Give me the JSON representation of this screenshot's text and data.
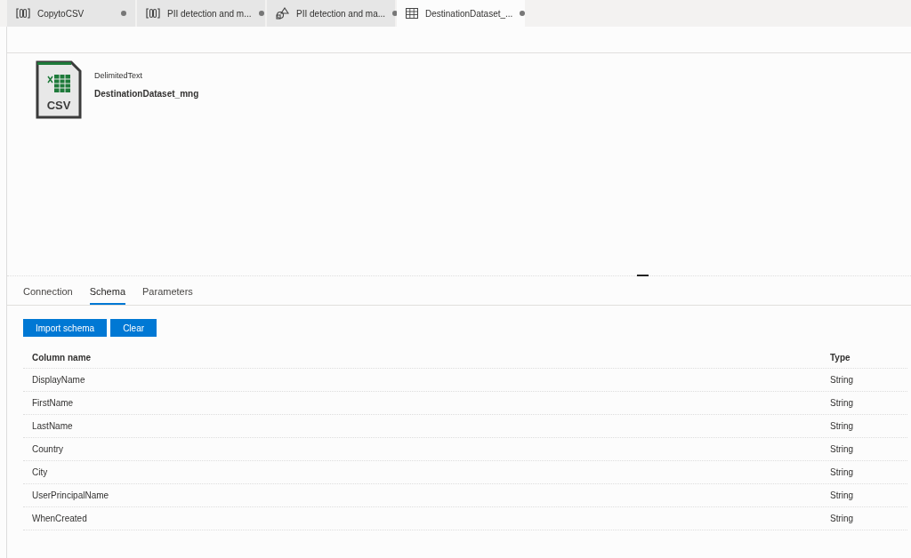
{
  "editor_tabs": [
    {
      "kind": "pipeline",
      "label": "CopytoCSV",
      "selected": false
    },
    {
      "kind": "pipeline",
      "label": "PII detection and m...",
      "selected": false
    },
    {
      "kind": "dataflow",
      "label": "PII detection and ma...",
      "selected": false
    },
    {
      "kind": "dataset",
      "label": "DestinationDataset_...",
      "selected": true
    }
  ],
  "dataset": {
    "type": "DelimitedText",
    "name": "DestinationDataset_mng",
    "icon_label": "CSV"
  },
  "section_tabs": [
    {
      "label": "Connection",
      "selected": false
    },
    {
      "label": "Schema",
      "selected": true
    },
    {
      "label": "Parameters",
      "selected": false
    }
  ],
  "buttons": [
    "Import schema",
    "Clear"
  ],
  "table": {
    "columns": [
      "Column name",
      "Type"
    ],
    "rows": [
      [
        "DisplayName",
        "String"
      ],
      [
        "FirstName",
        "String"
      ],
      [
        "LastName",
        "String"
      ],
      [
        "Country",
        "String"
      ],
      [
        "City",
        "String"
      ],
      [
        "UserPrincipalName",
        "String"
      ],
      [
        "WhenCreated",
        "String"
      ]
    ]
  }
}
